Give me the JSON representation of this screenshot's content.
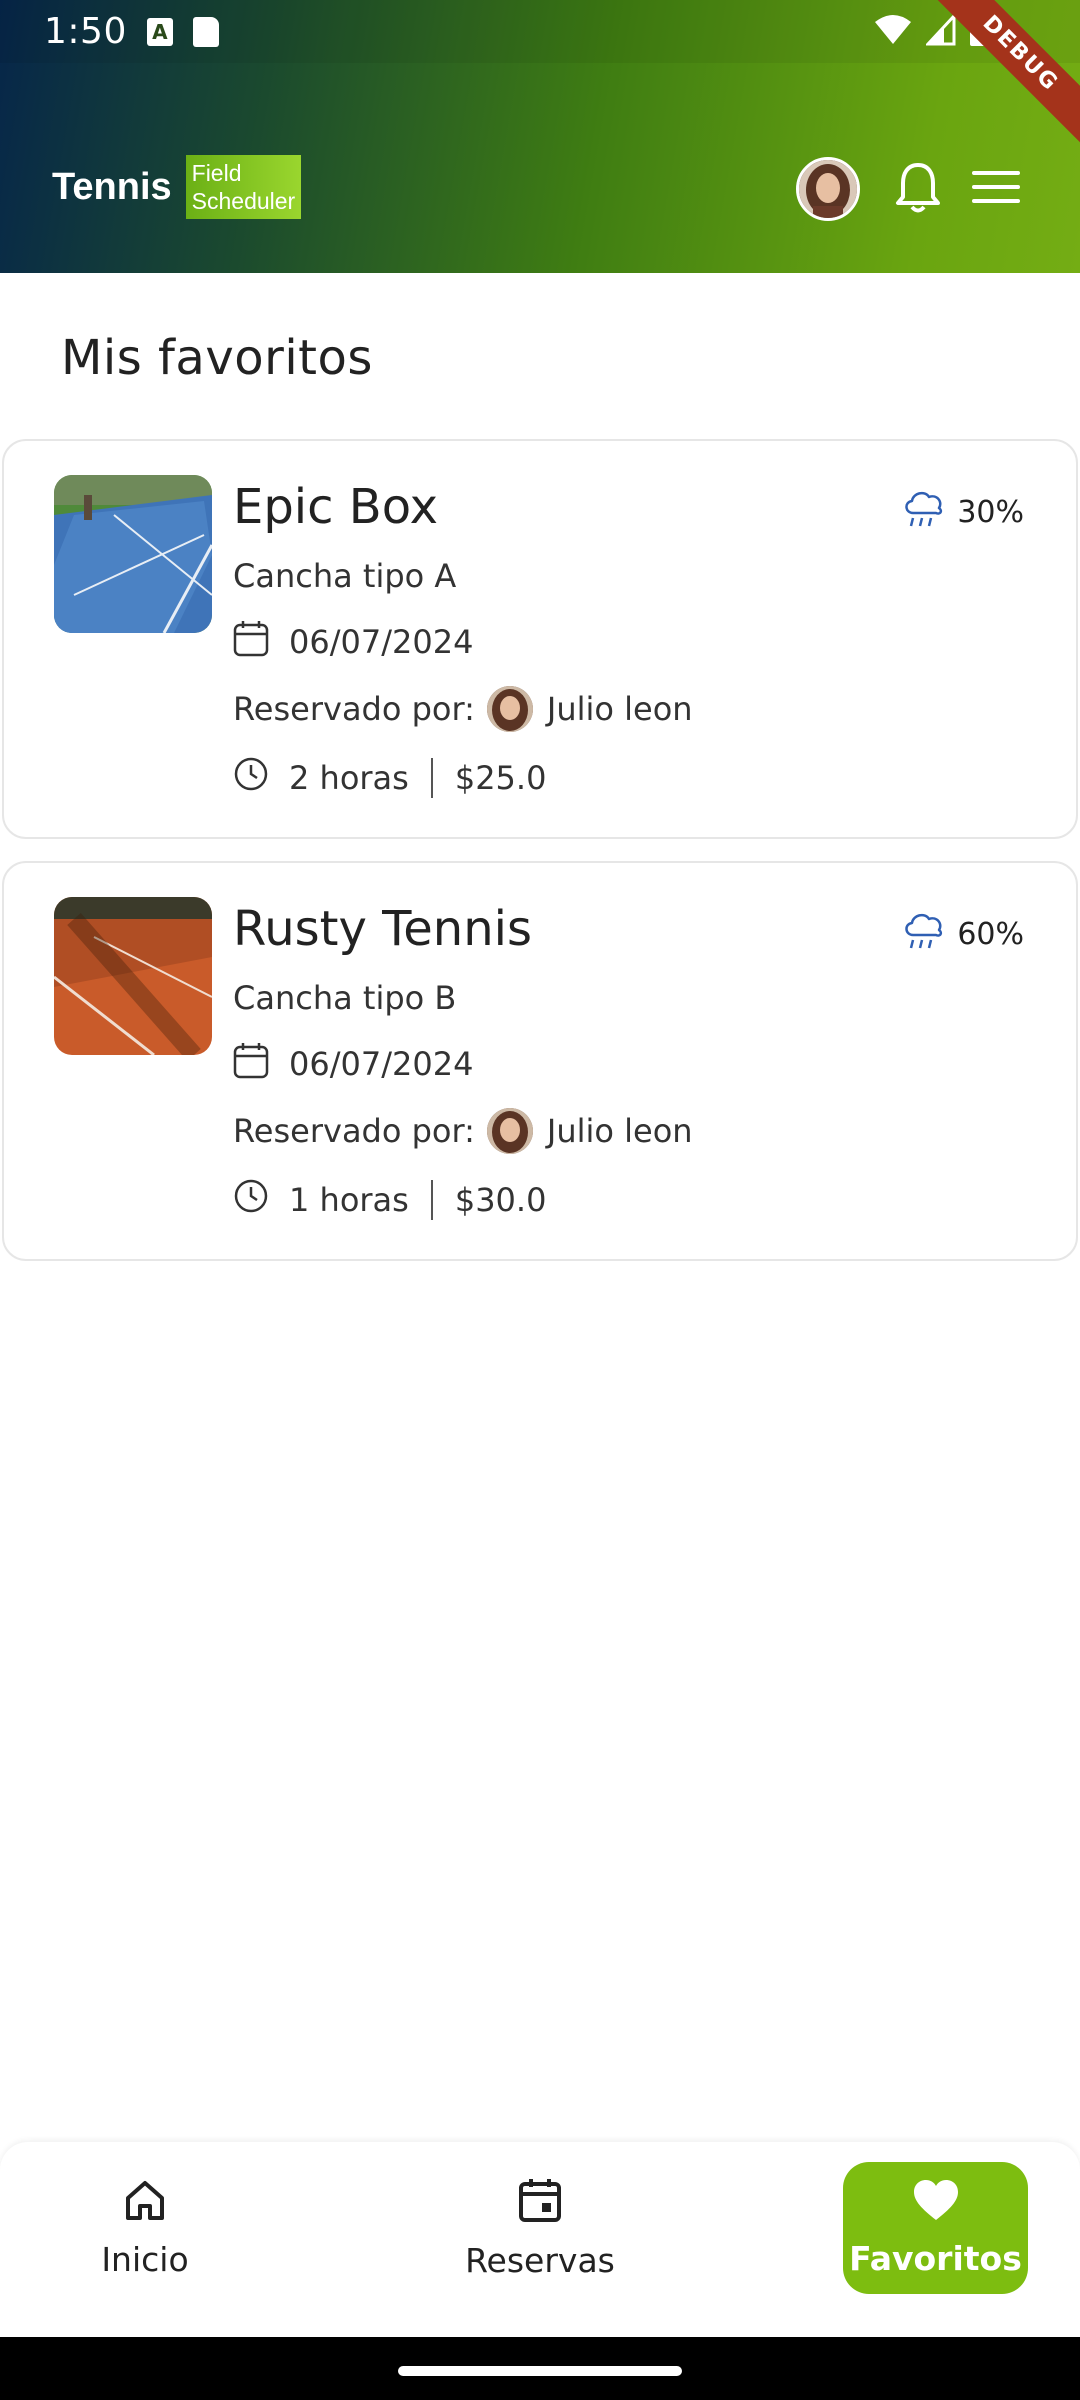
{
  "status_bar": {
    "time": "1:50",
    "notif_icon_letter": "A"
  },
  "debug_ribbon": "DEBUG",
  "header": {
    "brand_main": "Tennis",
    "brand_sub_line1": "Field",
    "brand_sub_line2": "Scheduler"
  },
  "page_title": "Mis favoritos",
  "favorites": [
    {
      "name": "Epic Box",
      "court_type": "Cancha tipo A",
      "date": "06/07/2024",
      "reserved_by_label": "Reservado por:",
      "reserved_by": "Julio leon",
      "duration": "2 horas",
      "price": "$25.0",
      "rain_chance": "30%",
      "court_color": "blue"
    },
    {
      "name": "Rusty Tennis",
      "court_type": "Cancha tipo B",
      "date": "06/07/2024",
      "reserved_by_label": "Reservado por:",
      "reserved_by": "Julio leon",
      "duration": "1 horas",
      "price": "$30.0",
      "rain_chance": "60%",
      "court_color": "clay"
    }
  ],
  "bottom_nav": {
    "items": [
      {
        "label": "Inicio",
        "icon": "home-icon"
      },
      {
        "label": "Reservas",
        "icon": "calendar-icon"
      },
      {
        "label": "Favoritos",
        "icon": "heart-icon",
        "active": true
      }
    ]
  },
  "colors": {
    "accent": "#7dbd10",
    "weather_icon": "#2f5fb3"
  }
}
